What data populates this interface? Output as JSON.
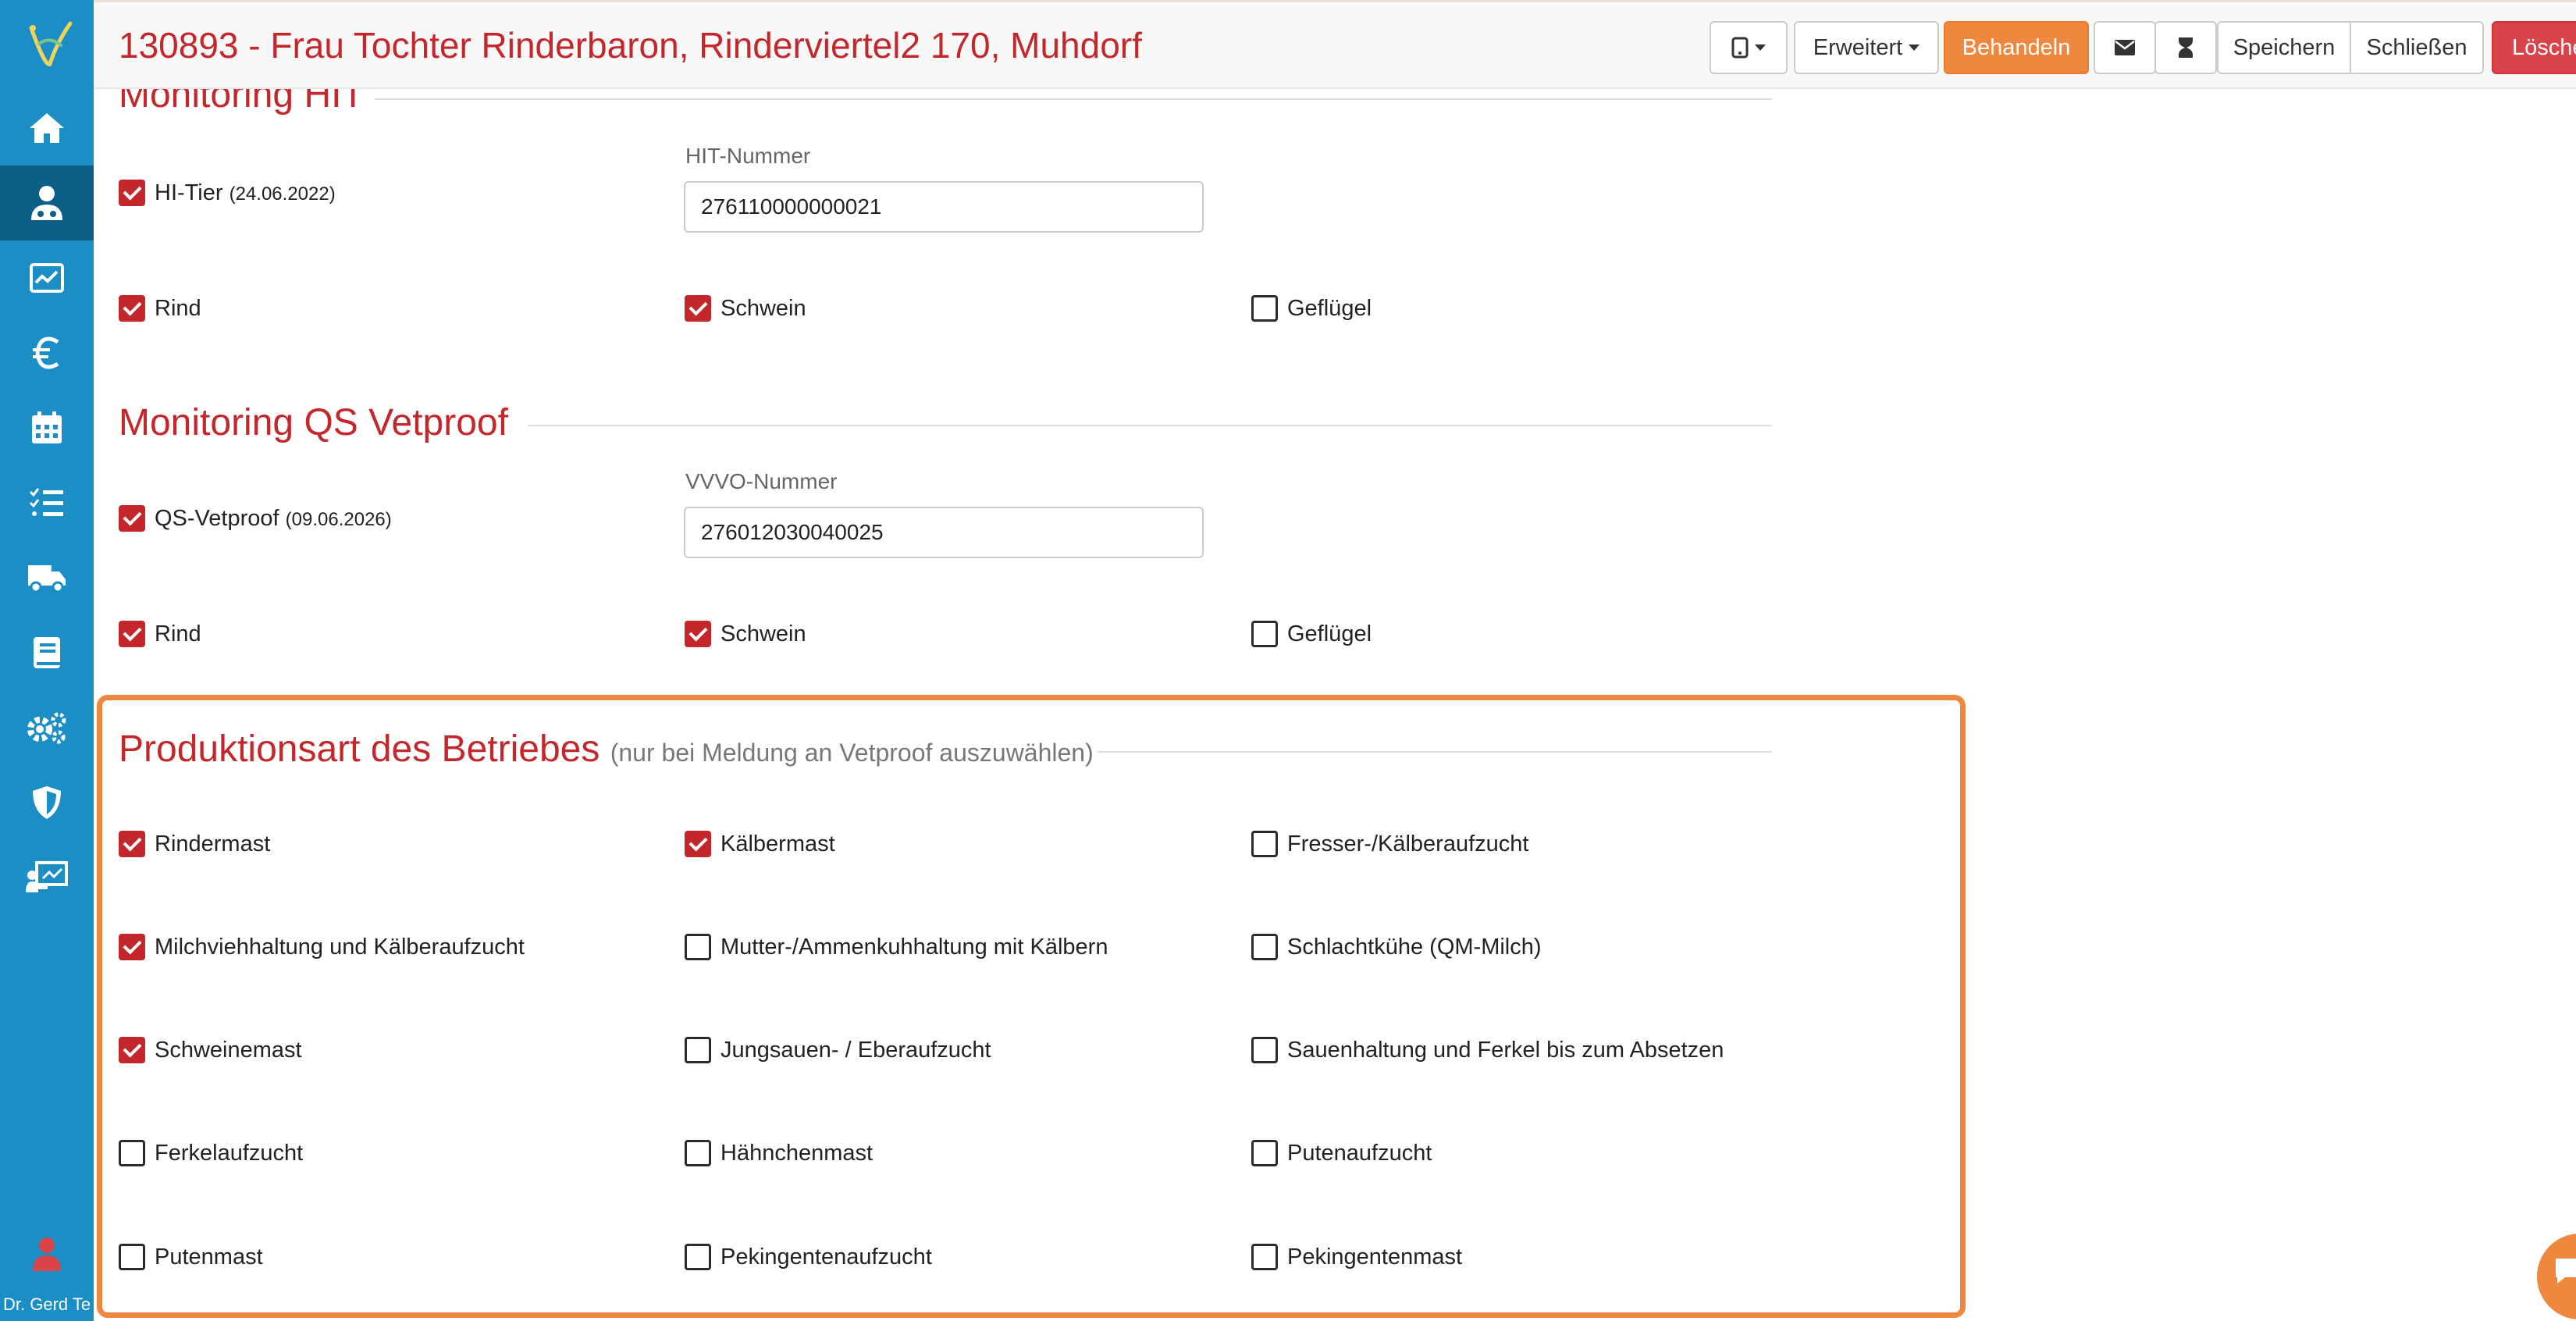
{
  "header": {
    "title": "130893 - Frau Tochter Rinderbaron, Rinderviertel2 170, Muhdorf",
    "erweitert_label": "Erweitert",
    "behandeln_label": "Behandeln",
    "speichern_label": "Speichern",
    "schliessen_label": "Schließen",
    "loeschen_label": "Lösche"
  },
  "sidebar": {
    "items": [
      {
        "icon": "home-icon"
      },
      {
        "icon": "user-doctor-icon",
        "active": true
      },
      {
        "icon": "monitor-chart-icon"
      },
      {
        "icon": "euro-icon"
      },
      {
        "icon": "calendar-icon"
      },
      {
        "icon": "task-list-icon"
      },
      {
        "icon": "truck-icon"
      },
      {
        "icon": "book-icon"
      },
      {
        "icon": "gears-icon"
      },
      {
        "icon": "shield-icon"
      },
      {
        "icon": "presentation-icon"
      }
    ],
    "user_name": "Dr. Gerd Te"
  },
  "hit": {
    "title": "Monitoring HIT",
    "hi_tier_label": "HI-Tier",
    "hi_tier_date": "(24.06.2022)",
    "hi_tier_checked": true,
    "number_label": "HIT-Nummer",
    "number_value": "276110000000021",
    "species": [
      {
        "label": "Rind",
        "checked": true
      },
      {
        "label": "Schwein",
        "checked": true
      },
      {
        "label": "Geflügel",
        "checked": false
      }
    ]
  },
  "qs": {
    "title": "Monitoring QS Vetproof",
    "qs_label": "QS-Vetproof",
    "qs_date": "(09.06.2026)",
    "qs_checked": true,
    "number_label": "VVVO-Nummer",
    "number_value": "276012030040025",
    "species": [
      {
        "label": "Rind",
        "checked": true
      },
      {
        "label": "Schwein",
        "checked": true
      },
      {
        "label": "Geflügel",
        "checked": false
      }
    ]
  },
  "production": {
    "title": "Produktionsart des Betriebes",
    "subtitle": "(nur bei Meldung an Vetproof auszuwählen)",
    "options": [
      {
        "label": "Rindermast",
        "checked": true
      },
      {
        "label": "Kälbermast",
        "checked": true
      },
      {
        "label": "Fresser-/Kälberaufzucht",
        "checked": false
      },
      {
        "label": "Milchviehhaltung und Kälberaufzucht",
        "checked": true
      },
      {
        "label": "Mutter-/Ammenkuhhaltung mit Kälbern",
        "checked": false
      },
      {
        "label": "Schlachtkühe (QM-Milch)",
        "checked": false
      },
      {
        "label": "Schweinemast",
        "checked": true
      },
      {
        "label": "Jungsauen- / Eberaufzucht",
        "checked": false
      },
      {
        "label": "Sauenhaltung und Ferkel bis zum Absetzen",
        "checked": false
      },
      {
        "label": "Ferkelaufzucht",
        "checked": false
      },
      {
        "label": "Hähnchenmast",
        "checked": false
      },
      {
        "label": "Putenaufzucht",
        "checked": false
      },
      {
        "label": "Putenmast",
        "checked": false
      },
      {
        "label": "Pekingentenaufzucht",
        "checked": false
      },
      {
        "label": "Pekingentenmast",
        "checked": false
      }
    ]
  },
  "colors": {
    "brand_red": "#c3272b",
    "sidebar_blue": "#1b8fc5",
    "accent_orange": "#f0873f"
  }
}
